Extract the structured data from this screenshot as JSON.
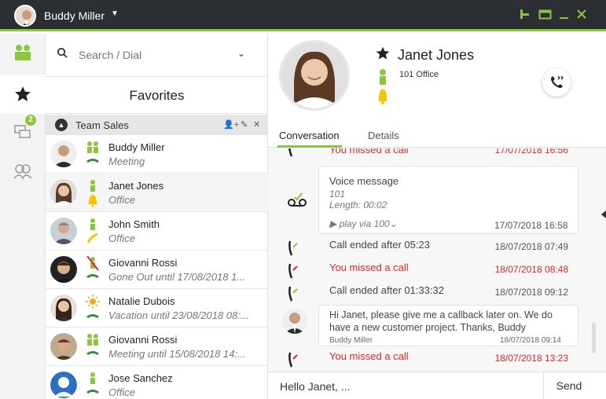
{
  "window": {
    "user_name": "Buddy Miller",
    "accent": "#8cc63f",
    "titlebar_bg": "#2b2f33"
  },
  "search": {
    "placeholder": "Search / Dial"
  },
  "favorites": {
    "title": "Favorites",
    "group_name": "Team Sales",
    "contacts": [
      {
        "name": "Buddy Miller",
        "status": "Meeting",
        "presence": "meeting"
      },
      {
        "name": "Janet Jones",
        "status": "Office",
        "presence": "office-ringing"
      },
      {
        "name": "John Smith",
        "status": "Office",
        "presence": "office-call"
      },
      {
        "name": "Giovanni Rossi",
        "status": "Gone Out until 17/08/2018 1...",
        "presence": "gone-out"
      },
      {
        "name": "Natalie Dubois",
        "status": "Vacation until 23/08/2018 08:...",
        "presence": "vacation"
      },
      {
        "name": "Giovanni Rossi",
        "status": "Meeting until 15/08/2018 14:...",
        "presence": "meeting"
      },
      {
        "name": "Jose Sanchez",
        "status": "Office",
        "presence": "office"
      }
    ]
  },
  "nav": {
    "badge_count": "2"
  },
  "profile": {
    "name": "Janet Jones",
    "extension": "101 Office",
    "tabs": [
      "Conversation",
      "Details"
    ]
  },
  "conversation": {
    "partial_top": {
      "text": "You missed a call",
      "date": "17/07/2018 16:56"
    },
    "voice": {
      "title": "Voice message",
      "number": "101",
      "length": "Length: 00:02",
      "play": "▶ play via 100⌄",
      "date": "17/07/2018 16:58"
    },
    "rows": [
      {
        "text": "Call ended after 05:23",
        "date": "18/07/2018 07:49",
        "missed": false
      },
      {
        "text": "You missed a call",
        "date": "18/07/2018 08:48",
        "missed": true
      },
      {
        "text": "Call ended after 01:33:32",
        "date": "18/07/2018 09:12",
        "missed": false
      }
    ],
    "chat": {
      "text": "Hi Janet, please give me a callback later on. We do have a new customer project. Thanks, Buddy",
      "author": "Buddy Miller",
      "date": "18/07/2018 09:14"
    },
    "last": {
      "text": "You missed a call",
      "date": "18/07/2018 13:23"
    }
  },
  "compose": {
    "value": "Hello Janet, ...",
    "send_label": "Send"
  }
}
